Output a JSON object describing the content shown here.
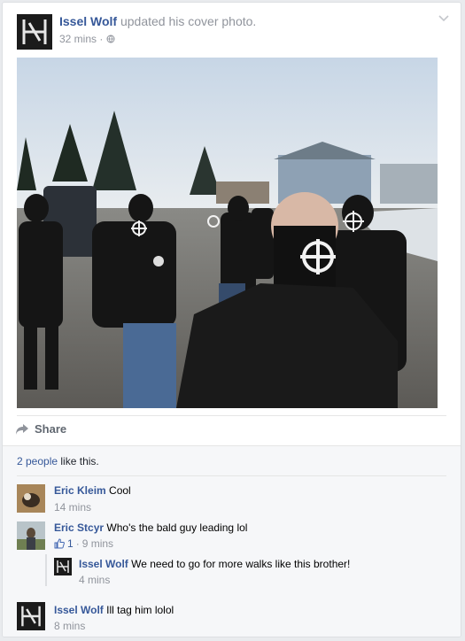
{
  "post": {
    "author": "Issel Wolf",
    "action": "updated his cover photo.",
    "time": "32 mins",
    "separator": "·",
    "privacy_icon": "globe-icon"
  },
  "actions": {
    "share_label": "Share"
  },
  "likes": {
    "count_text": "2 people",
    "suffix": "like this."
  },
  "comments": [
    {
      "author": "Eric Kleim",
      "text": "Cool",
      "time": "14 mins"
    },
    {
      "author": "Eric Stcyr",
      "text": "Who's the bald guy leading lol",
      "like_count": "1",
      "time": "9 mins"
    },
    {
      "author": "Issel Wolf",
      "text": "We need to go for more walks like this brother!",
      "time": "4 mins",
      "is_reply": true
    },
    {
      "author": "Issel Wolf",
      "text": "Ill tag him lolol",
      "time": "8 mins"
    }
  ],
  "colors": {
    "link": "#365899",
    "meta": "#90949c",
    "background": "#e9ebee"
  }
}
